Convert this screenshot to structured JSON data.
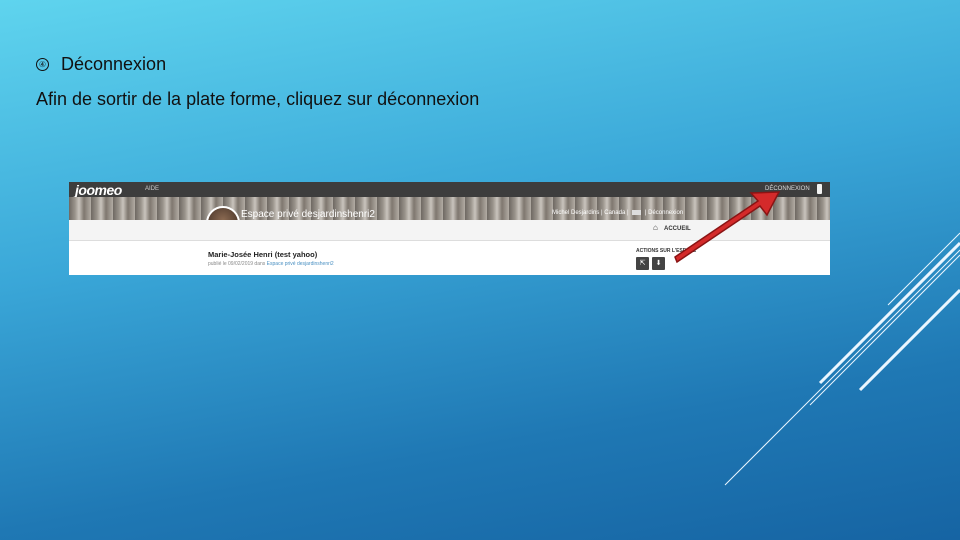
{
  "slide": {
    "bullet_icon": "④",
    "heading": "Déconnexion",
    "body_text": "Afin de sortir de la plate forme, cliquez sur déconnexion"
  },
  "screenshot": {
    "topbar": {
      "logo": "joomeo",
      "aide_label": "AIDE",
      "deconnexion_label": "DÉCONNEXION"
    },
    "banner": {
      "space_title": "Espace privé desjardinshenri2",
      "user_name": "Michel Desjardins",
      "country": "Canada",
      "logout_link": "Déconnexion"
    },
    "subnav": {
      "home_label": "ACCUEIL"
    },
    "post": {
      "author": "Marie-Josée Henri (test yahoo)",
      "meta_prefix": "publié le 09/02/2019 dans ",
      "meta_link": "Espace privé desjardinshenri2"
    },
    "actions": {
      "label": "ACTIONS SUR L'ESPACE"
    }
  },
  "colors": {
    "arrow": "#d42a2a",
    "topbar": "#3d3d3d"
  }
}
